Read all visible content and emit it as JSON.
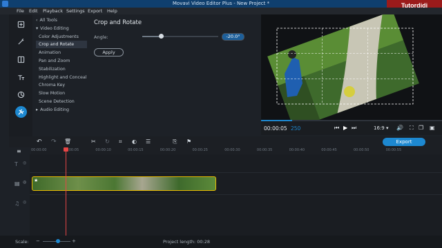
{
  "window": {
    "title": "Movavi Video Editor Plus - New Project *"
  },
  "brand": {
    "label": "Tutordidi"
  },
  "menu": [
    {
      "id": "file",
      "label": "File"
    },
    {
      "id": "edit",
      "label": "Edit"
    },
    {
      "id": "playback",
      "label": "Playback"
    },
    {
      "id": "settings",
      "label": "Settings"
    },
    {
      "id": "export",
      "label": "Export"
    },
    {
      "id": "help",
      "label": "Help"
    }
  ],
  "sidebar_tools": [
    {
      "name": "import-icon"
    },
    {
      "name": "magic-filters-icon"
    },
    {
      "name": "transitions-icon"
    },
    {
      "name": "titles-icon"
    },
    {
      "name": "stickers-icon"
    },
    {
      "name": "more-tools-icon"
    }
  ],
  "tools_list": [
    {
      "label": "All Tools",
      "indent": 0,
      "arrow": "‹"
    },
    {
      "label": "Video Editing",
      "indent": 0,
      "arrow": "▾"
    },
    {
      "label": "Color Adjustments",
      "indent": 1,
      "arrow": ""
    },
    {
      "label": "Crop and Rotate",
      "indent": 1,
      "arrow": "",
      "selected": true
    },
    {
      "label": "Animation",
      "indent": 1,
      "arrow": ""
    },
    {
      "label": "Pan and Zoom",
      "indent": 1,
      "arrow": ""
    },
    {
      "label": "Stabilization",
      "indent": 1,
      "arrow": ""
    },
    {
      "label": "Highlight and Conceal",
      "indent": 1,
      "arrow": ""
    },
    {
      "label": "Chroma Key",
      "indent": 1,
      "arrow": ""
    },
    {
      "label": "Slow Motion",
      "indent": 1,
      "arrow": ""
    },
    {
      "label": "Scene Detection",
      "indent": 1,
      "arrow": ""
    },
    {
      "label": "Audio Editing",
      "indent": 0,
      "arrow": "▸"
    }
  ],
  "crop_panel": {
    "heading": "Crop and Rotate",
    "angle_label": "Angle:",
    "angle_value": "-20.0°",
    "angle_slider_position": 0.25,
    "apply_label": "Apply"
  },
  "player": {
    "time_current": "00:00:05",
    "time_frames": "250",
    "progress": 0.17,
    "aspect": "16:9 ▾"
  },
  "export": {
    "label": "Export"
  },
  "ruler_ticks": [
    "00:00:00",
    "00:00:05",
    "00:00:10",
    "00:00:15",
    "00:00:20",
    "00:00:25",
    "00:00:30",
    "00:00:35",
    "00:00:40",
    "00:00:45",
    "00:00:50",
    "00:00:55"
  ],
  "status": {
    "scale_label": "Scale:",
    "project_length": "Project length:  00:28"
  },
  "colors": {
    "accent": "#1d88d0",
    "title_bar": "#0f3f6e",
    "brand_bg": "#9b1b1b",
    "clip_border": "#e8b900",
    "playhead": "#e64545"
  }
}
